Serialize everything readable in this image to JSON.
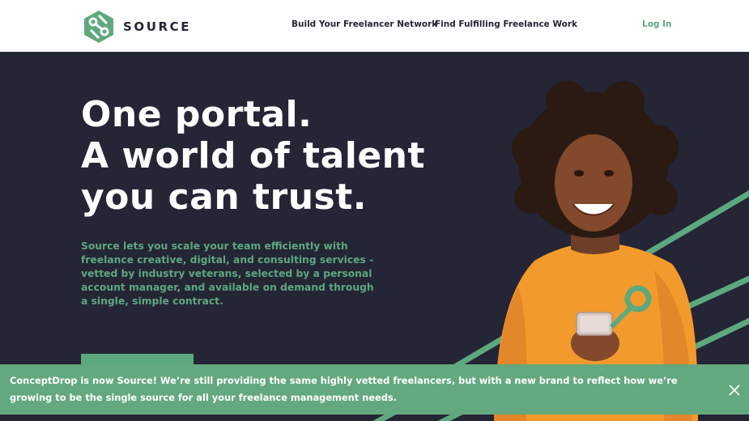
{
  "header": {
    "brand": "SOURCE",
    "nav": [
      "Build Your Freelancer Network",
      "Find Fulfilling Freelance Work"
    ],
    "login": "Log In"
  },
  "hero": {
    "headline": [
      "One portal.",
      "A world of talent",
      "you can trust."
    ],
    "intro": "Source lets you scale your team efficiently with freelance creative, digital, and consulting services - vetted by industry veterans, selected by a personal account manager, and available on demand through a single, simple contract."
  },
  "banner": {
    "text": "ConceptDrop is now Source! We’re still providing the same highly vetted freelancers, but with a new brand to reflect how we’re growing to be the single source for all your freelance management needs."
  },
  "icons": {
    "logo": "source-hexagon-logo",
    "close": "close-icon"
  },
  "colors": {
    "brand_green": "#5ea87e",
    "dark_navy": "#242535",
    "banner_green": "#64a87f",
    "sweater_orange": "#f39a2c"
  }
}
